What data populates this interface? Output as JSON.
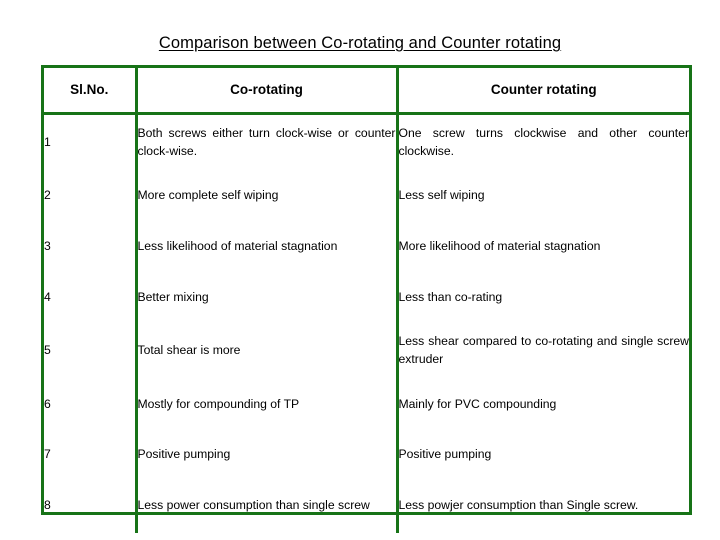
{
  "slide": {
    "title": "Comparison between Co-rotating and Counter rotating",
    "background_color": "#ffffff",
    "accent_color": "#177317",
    "text_color": "#000000"
  },
  "table": {
    "name": "comparison-table",
    "columns": [
      {
        "key": "sl",
        "label": "Sl.No."
      },
      {
        "key": "co",
        "label": "Co-rotating"
      },
      {
        "key": "counter",
        "label": "Counter rotating"
      }
    ],
    "rows": [
      {
        "sl": "1",
        "co": "Both screws either turn clock-wise or counter clock-wise.",
        "counter": "One screw turns clockwise and other counter clockwise."
      },
      {
        "sl": "2",
        "co": "More complete self wiping",
        "counter": "Less self wiping"
      },
      {
        "sl": "3",
        "co": "Less likelihood of material stagnation",
        "counter": "More likelihood of material stagnation"
      },
      {
        "sl": "4",
        "co": "Better mixing",
        "counter": "Less than co-rating"
      },
      {
        "sl": "5",
        "co": "Total shear is more",
        "counter": "Less shear compared to co-rotating and single screw extruder"
      },
      {
        "sl": "6",
        "co": "Mostly for compounding of TP",
        "counter": "Mainly for PVC compounding"
      },
      {
        "sl": "7",
        "co": "Positive pumping",
        "counter": "Positive pumping"
      },
      {
        "sl": "8",
        "co": "Less power consumption than single screw",
        "counter": "Less powjer consumption than Single screw."
      }
    ]
  }
}
